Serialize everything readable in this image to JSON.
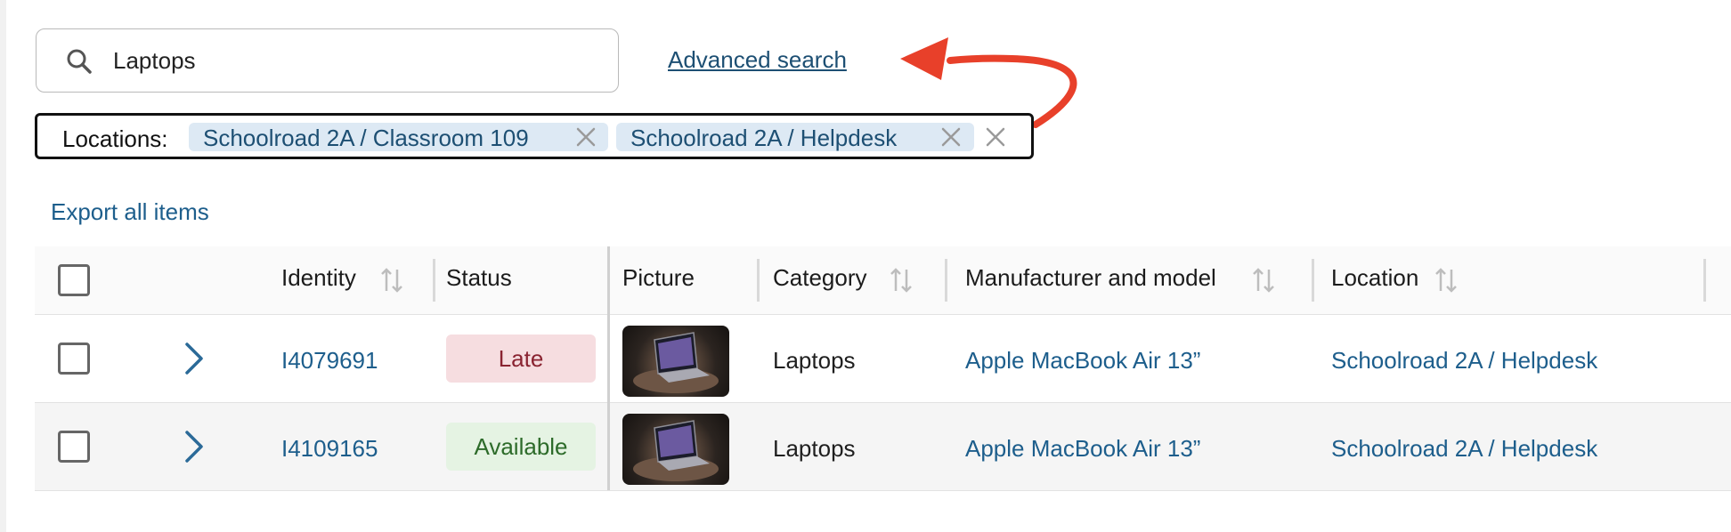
{
  "search": {
    "value": "Laptops",
    "advanced_label": "Advanced search"
  },
  "filters": {
    "label": "Locations:",
    "chips": [
      {
        "label": "Schoolroad 2A / Classroom 109"
      },
      {
        "label": "Schoolroad 2A / Helpdesk"
      }
    ]
  },
  "export_label": "Export all items",
  "table": {
    "columns": {
      "identity": "Identity",
      "status": "Status",
      "picture": "Picture",
      "category": "Category",
      "manufacturer": "Manufacturer and model",
      "location": "Location"
    },
    "rows": [
      {
        "identity": "I4079691",
        "status": "Late",
        "category": "Laptops",
        "manufacturer": "Apple MacBook Air 13”",
        "location": "Schoolroad 2A / Helpdesk"
      },
      {
        "identity": "I4109165",
        "status": "Available",
        "category": "Laptops",
        "manufacturer": "Apple MacBook Air 13”",
        "location": "Schoolroad 2A / Helpdesk"
      }
    ]
  },
  "colors": {
    "link": "#1d5e8c",
    "late_bg": "#f6dde0",
    "late_text": "#8a2331",
    "available_bg": "#e5f3e3",
    "available_text": "#2d6b2a",
    "chip_bg": "#dde9f4",
    "arrow": "#e8402a"
  },
  "icons": {
    "search": "search-icon",
    "chip_remove": "close-icon",
    "clear_filters": "close-icon",
    "sort": "sort-icon",
    "expand": "chevron-right-icon",
    "annotation": "red-arrow-icon"
  }
}
